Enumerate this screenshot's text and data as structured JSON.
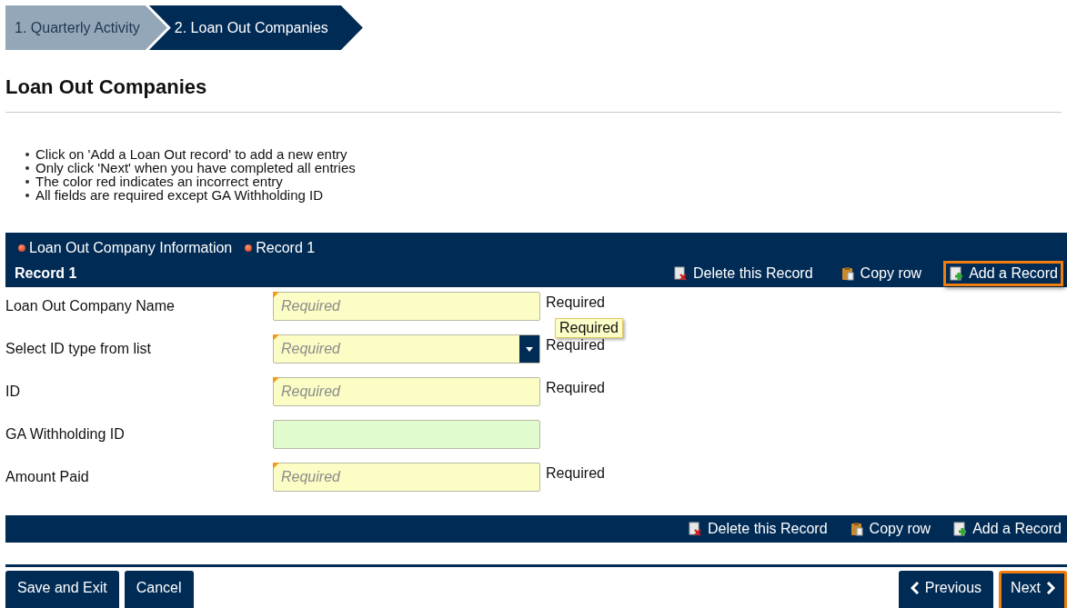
{
  "steps": [
    {
      "label": "1. Quarterly Activity",
      "selected": false
    },
    {
      "label": "2. Loan Out Companies",
      "selected": true
    }
  ],
  "title": "Loan Out Companies",
  "instructions": [
    "Click on 'Add a Loan Out record' to add a new entry",
    "Only click 'Next' when you have completed all entries",
    "The color red indicates an incorrect entry",
    "All fields are required except GA Withholding ID"
  ],
  "record_panel": {
    "breadcrumb": [
      "Loan Out Company Information",
      "Record 1"
    ],
    "record_title": "Record 1",
    "actions": [
      {
        "kind": "delete",
        "label": "Delete this Record",
        "highlighted": false
      },
      {
        "kind": "copy",
        "label": "Copy row",
        "highlighted": false
      },
      {
        "kind": "add",
        "label": "Add a Record",
        "highlighted": true
      }
    ]
  },
  "fields": [
    {
      "label": "Loan Out Company Name",
      "kind": "text",
      "placeholder": "Required",
      "required": true,
      "note": "Required",
      "tooltip": "Required"
    },
    {
      "label": "Select ID type from list",
      "kind": "select",
      "placeholder": "Required",
      "required": true,
      "note": "Required"
    },
    {
      "label": "ID",
      "kind": "text",
      "placeholder": "Required",
      "required": true,
      "note": "Required"
    },
    {
      "label": "GA Withholding ID",
      "kind": "text",
      "required": false
    },
    {
      "label": "Amount Paid",
      "kind": "text",
      "placeholder": "Required",
      "required": true,
      "note": "Required"
    }
  ],
  "footer_actions": [
    {
      "kind": "delete",
      "label": "Delete this Record",
      "highlighted": false
    },
    {
      "kind": "copy",
      "label": "Copy row",
      "highlighted": false
    },
    {
      "kind": "add",
      "label": "Add a Record",
      "highlighted": false
    }
  ],
  "buttons_left": [
    {
      "label": "Save and Exit",
      "highlighted": false
    },
    {
      "label": "Cancel",
      "highlighted": false
    }
  ],
  "buttons_right": [
    {
      "kind": "previous",
      "label": "Previous",
      "highlighted": false
    },
    {
      "kind": "next",
      "label": "Next",
      "highlighted": true
    }
  ]
}
